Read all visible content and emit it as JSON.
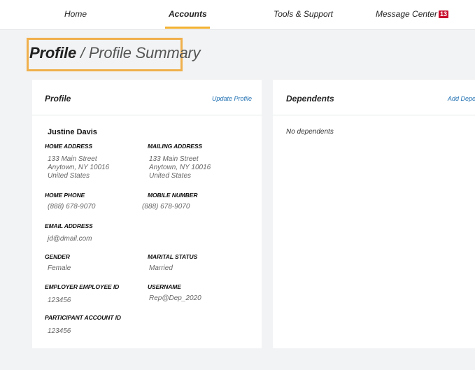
{
  "nav": {
    "home": "Home",
    "accounts": "Accounts",
    "tools": "Tools & Support",
    "messages": "Message Center",
    "message_count": "13"
  },
  "breadcrumb": {
    "current": "Profile",
    "separator": " / ",
    "page": "Profile Summary"
  },
  "profile": {
    "title": "Profile",
    "update_link": "Update Profile",
    "name": "Justine Davis",
    "home_address_label": "HOME ADDRESS",
    "home_address": [
      "133 Main Street",
      "Anytown, NY 10016",
      "United States"
    ],
    "mailing_address_label": "MAILING ADDRESS",
    "mailing_address": [
      "133 Main Street",
      "Anytown, NY 10016",
      "United States"
    ],
    "home_phone_label": "HOME PHONE",
    "home_phone": "(888) 678-9070",
    "mobile_label": "MOBILE NUMBER",
    "mobile": "(888) 678-9070",
    "email_label": "EMAIL ADDRESS",
    "email": "jd@dmail.com",
    "gender_label": "GENDER",
    "gender": "Female",
    "marital_label": "MARITAL STATUS",
    "marital": "Married",
    "employer_id_label": "EMPLOYER EMPLOYEE ID",
    "employer_id": "123456",
    "username_label": "USERNAME",
    "username": "Rep@Dep_2020",
    "participant_id_label": "PARTICIPANT ACCOUNT ID",
    "participant_id": "123456"
  },
  "dependents": {
    "title": "Dependents",
    "add_link": "Add Depe",
    "empty_text": "No dependents"
  },
  "colors": {
    "accent": "#f3b233",
    "title_border": "#f0b04c",
    "badge": "#c8102e",
    "link": "#1f6fb2",
    "background": "#f2f3f4"
  }
}
